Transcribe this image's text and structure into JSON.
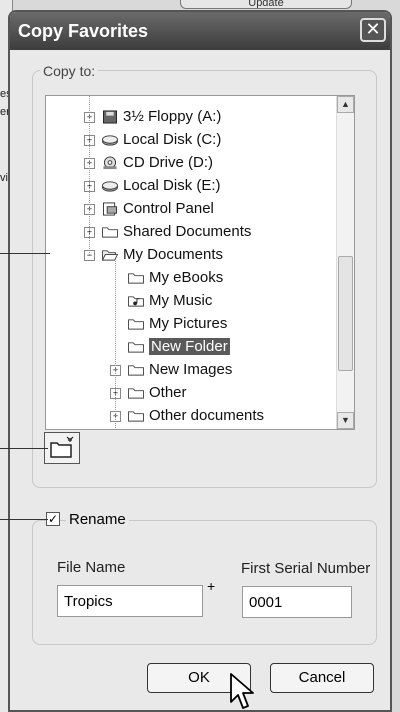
{
  "background": {
    "top_button_label": "Update",
    "left_fragments": [
      "es",
      "er",
      "vi"
    ]
  },
  "dialog": {
    "title": "Copy Favorites",
    "close_symbol": "✕",
    "copy_to_label": "Copy to:",
    "tree": [
      {
        "label": "3½ Floppy (A:)",
        "icon": "floppy-icon",
        "expander": "+",
        "level": 0
      },
      {
        "label": "Local Disk (C:)",
        "icon": "disk-icon",
        "expander": "+",
        "level": 0
      },
      {
        "label": "CD Drive (D:)",
        "icon": "cd-icon",
        "expander": "+",
        "level": 0
      },
      {
        "label": "Local Disk (E:)",
        "icon": "disk-icon",
        "expander": "+",
        "level": 0
      },
      {
        "label": "Control Panel",
        "icon": "control-panel-icon",
        "expander": "+",
        "level": 0
      },
      {
        "label": "Shared Documents",
        "icon": "folder-icon",
        "expander": "+",
        "level": 0
      },
      {
        "label": "My Documents",
        "icon": "folder-open-icon",
        "expander": "−",
        "level": 0
      },
      {
        "label": "My eBooks",
        "icon": "folder-icon",
        "expander": "",
        "level": 1
      },
      {
        "label": "My Music",
        "icon": "music-folder-icon",
        "expander": "",
        "level": 1
      },
      {
        "label": "My Pictures",
        "icon": "folder-icon",
        "expander": "",
        "level": 1
      },
      {
        "label": "New Folder",
        "icon": "folder-icon",
        "expander": "",
        "level": 1,
        "selected": true
      },
      {
        "label": "New Images",
        "icon": "folder-icon",
        "expander": "+",
        "level": 1
      },
      {
        "label": "Other",
        "icon": "folder-icon",
        "expander": "+",
        "level": 1
      },
      {
        "label": "Other documents",
        "icon": "folder-icon",
        "expander": "+",
        "level": 1
      }
    ],
    "new_folder_icon": "new-folder-icon",
    "rename": {
      "checked": true,
      "check_glyph": "✓",
      "label": "Rename",
      "file_name_label": "File Name",
      "file_name_value": "Tropics",
      "plus_sign": "+",
      "serial_label": "First Serial Number",
      "serial_value": "0001"
    },
    "ok_label": "OK",
    "cancel_label": "Cancel"
  }
}
